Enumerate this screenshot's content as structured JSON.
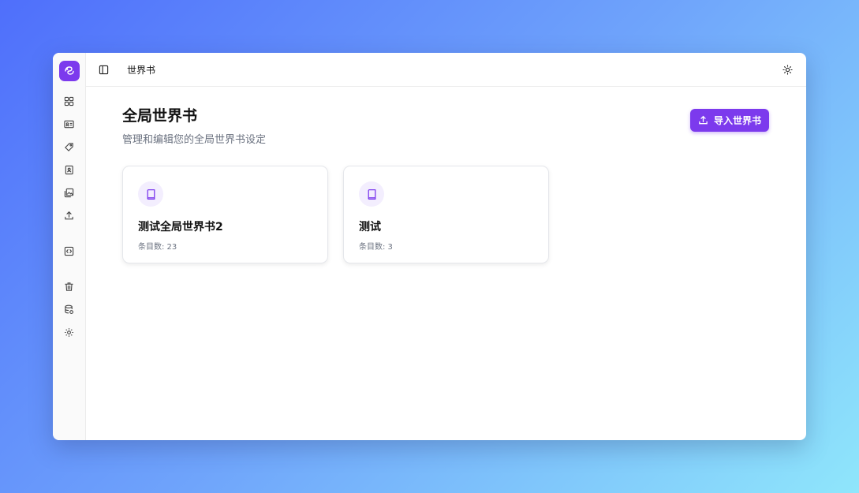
{
  "colors": {
    "accent": "#7c3aed",
    "icon_bg": "#f3eefe",
    "muted": "#6b7280"
  },
  "rail": {
    "logo_icon": "sparkle-logo-icon",
    "items": [
      {
        "icon": "dashboard-grid-icon"
      },
      {
        "icon": "id-card-icon"
      },
      {
        "icon": "tag-icon"
      },
      {
        "icon": "contact-book-icon"
      },
      {
        "icon": "gallery-icon"
      },
      {
        "icon": "upload-icon"
      },
      {
        "icon": "code-box-icon"
      },
      {
        "icon": "trash-icon"
      },
      {
        "icon": "database-icon"
      },
      {
        "icon": "gear-icon"
      }
    ]
  },
  "topbar": {
    "breadcrumb": "世界书",
    "panel_icon": "sidebar-toggle-icon",
    "theme_icon": "sun-icon"
  },
  "page": {
    "title": "全局世界书",
    "subtitle": "管理和编辑您的全局世界书设定",
    "import_label": "导入世界书"
  },
  "cards": [
    {
      "title": "测试全局世界书2",
      "meta": "条目数: 23",
      "icon": "book-icon"
    },
    {
      "title": "测试",
      "meta": "条目数: 3",
      "icon": "book-icon"
    }
  ]
}
